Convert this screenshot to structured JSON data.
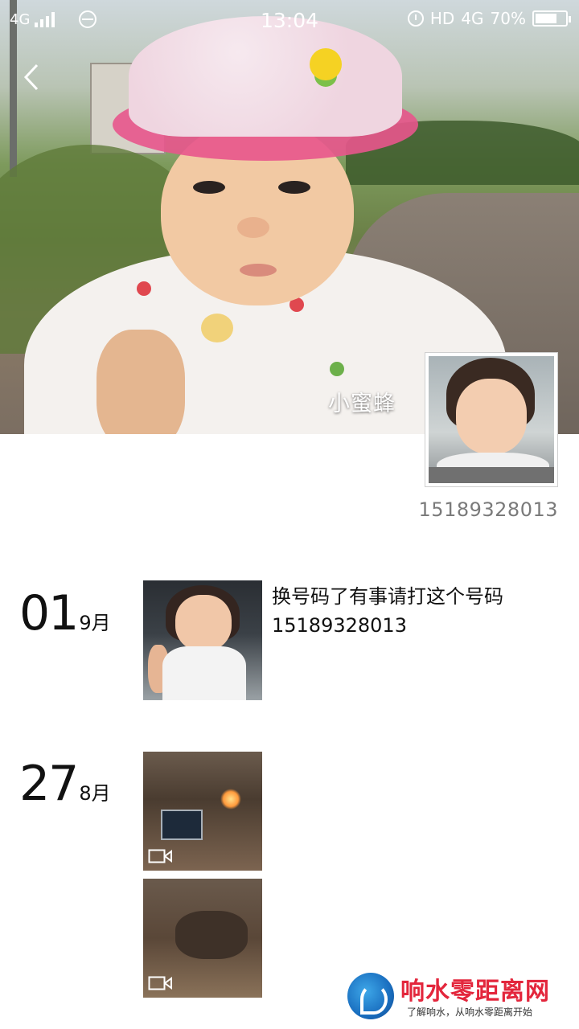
{
  "status_bar": {
    "network_left": "4G",
    "time": "13:04",
    "hd": "HD",
    "network_right": "4G",
    "battery": "70%"
  },
  "profile": {
    "name": "小蜜蜂",
    "phone": "15189328013"
  },
  "posts": [
    {
      "day": "01",
      "month": "9月",
      "text": "换号码了有事请打这个号码15189328013",
      "media": [
        "photo"
      ]
    },
    {
      "day": "27",
      "month": "8月",
      "text": "",
      "media": [
        "video",
        "video"
      ]
    }
  ],
  "icons": {
    "back": "chevron-left-icon",
    "video": "video-camera-icon",
    "alarm": "alarm-icon",
    "signal": "signal-icon",
    "battery": "battery-icon"
  },
  "watermark": {
    "title": "响水零距离网",
    "subtitle": "了解响水，从响水零距离开始"
  }
}
